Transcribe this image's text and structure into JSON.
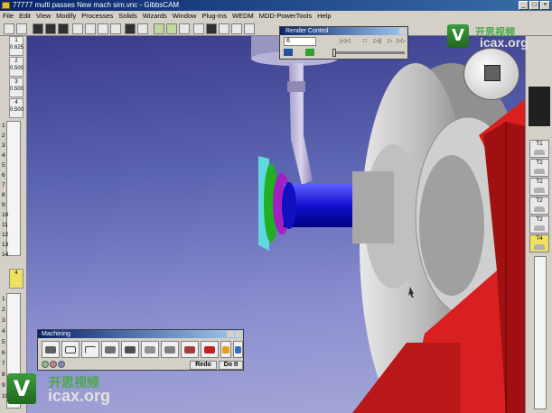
{
  "window": {
    "title": "77777 multi passes New mach sim.vnc - GibbsCAM",
    "controls": [
      "_",
      "□",
      "×"
    ]
  },
  "menu": {
    "items": [
      "File",
      "Edit",
      "View",
      "Modify",
      "Processes",
      "Solids",
      "Wizards",
      "Window",
      "Plug-Ins",
      "WEDM",
      "MDD-PowerTools",
      "Help"
    ]
  },
  "left_strip": {
    "slots": [
      {
        "number": "1",
        "value": "0.625"
      },
      {
        "number": "2",
        "value": "0.500"
      },
      {
        "number": "3",
        "value": "0.500"
      },
      {
        "number": "4",
        "value": "0.500"
      }
    ],
    "ruler_numbers": [
      "1",
      "2",
      "3",
      "4",
      "5",
      "6",
      "7",
      "8",
      "9",
      "10",
      "11",
      "12",
      "13",
      "14"
    ],
    "lower_numbers": [
      "1",
      "2",
      "3",
      "4",
      "5",
      "6",
      "7",
      "8",
      "9",
      "10"
    ],
    "active_label": "4"
  },
  "right_strip": {
    "tools": [
      "T1",
      "T2",
      "T2",
      "T2",
      "T2",
      "T4"
    ],
    "active_tool": "T4"
  },
  "render_control": {
    "title": "Render Control",
    "step_value": "6",
    "buttons": [
      "|◁◁",
      "□",
      "▷||",
      "▷",
      "▷▷"
    ]
  },
  "machining": {
    "title": "Machining",
    "redo_label": "Redo",
    "doit_label": "Do It"
  },
  "watermark": {
    "brand_cn": "开思视频",
    "url": "icax.org",
    "logo_letter": "V"
  },
  "colors": {
    "titlebar": "#0a246a",
    "chrome": "#d4d0c8",
    "part_red": "#d82020",
    "part_blue": "#2020e0",
    "part_green": "#20a020",
    "active_slot": "#f0e060"
  }
}
